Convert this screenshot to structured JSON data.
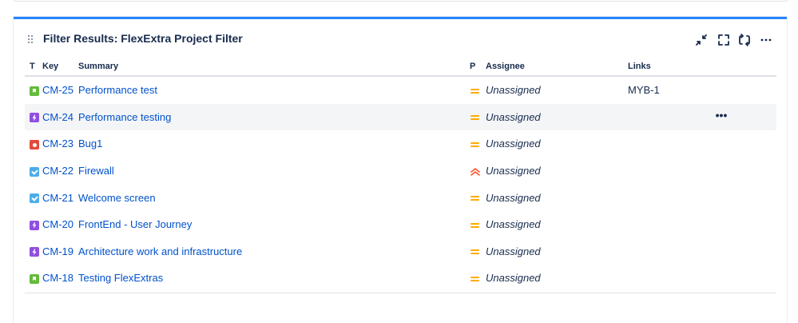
{
  "gadget": {
    "title": "Filter Results: FlexExtra Project Filter",
    "header_icons": [
      "minimize-icon",
      "fullscreen-icon",
      "refresh-icon",
      "more-options-icon"
    ]
  },
  "table": {
    "columns": {
      "type": "T",
      "key": "Key",
      "summary": "Summary",
      "priority": "P",
      "assignee": "Assignee",
      "links": "Links"
    },
    "rows": [
      {
        "type": "story",
        "key": "CM-25",
        "summary": "Performance test",
        "priority": "medium",
        "assignee": "Unassigned",
        "links": "MYB-1",
        "hovered": false
      },
      {
        "type": "epic",
        "key": "CM-24",
        "summary": "Performance testing",
        "priority": "medium",
        "assignee": "Unassigned",
        "links": "",
        "hovered": true
      },
      {
        "type": "bug",
        "key": "CM-23",
        "summary": "Bug1",
        "priority": "medium",
        "assignee": "Unassigned",
        "links": "",
        "hovered": false
      },
      {
        "type": "task",
        "key": "CM-22",
        "summary": "Firewall",
        "priority": "highest",
        "assignee": "Unassigned",
        "links": "",
        "hovered": false
      },
      {
        "type": "task",
        "key": "CM-21",
        "summary": "Welcome screen",
        "priority": "medium",
        "assignee": "Unassigned",
        "links": "",
        "hovered": false
      },
      {
        "type": "epic",
        "key": "CM-20",
        "summary": "FrontEnd - User Journey",
        "priority": "medium",
        "assignee": "Unassigned",
        "links": "",
        "hovered": false
      },
      {
        "type": "epic",
        "key": "CM-19",
        "summary": "Architecture work and infrastructure",
        "priority": "medium",
        "assignee": "Unassigned",
        "links": "",
        "hovered": false
      },
      {
        "type": "story",
        "key": "CM-18",
        "summary": "Testing FlexExtras",
        "priority": "medium",
        "assignee": "Unassigned",
        "links": "",
        "hovered": false
      }
    ],
    "row_actions_label": "•••"
  },
  "colors": {
    "accent": "#2684ff",
    "link": "#0052cc",
    "priority_medium": "#ffab00",
    "priority_highest": "#ff5630",
    "story": "#63ba3c",
    "epic": "#904ee2",
    "bug": "#e5493a",
    "task": "#4bade8"
  }
}
